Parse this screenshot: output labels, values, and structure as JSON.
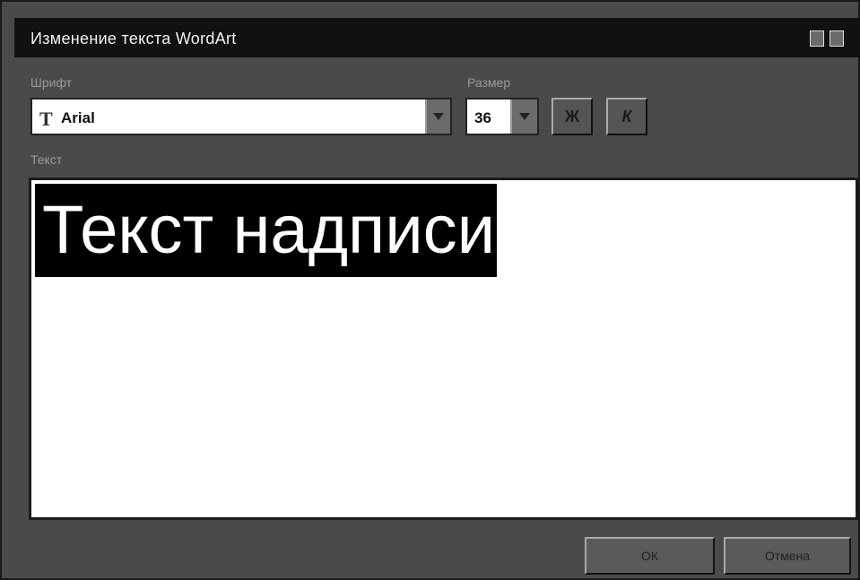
{
  "window": {
    "title": "Изменение текста WordArt"
  },
  "font": {
    "label": "Шрифт",
    "value": "Arial",
    "icon": "truetype-font-icon"
  },
  "size": {
    "label": "Размер",
    "value": "36"
  },
  "toolbar": {
    "bold_label": "Ж",
    "italic_label": "К"
  },
  "text_field": {
    "label": "Текст",
    "value": "Текст надписи"
  },
  "buttons": {
    "ok_label": "ОК",
    "cancel_label": "Отмена"
  },
  "colors": {
    "title_bar": "#111111",
    "dialog_background": "#4a4a4a",
    "selection": "#000000"
  }
}
